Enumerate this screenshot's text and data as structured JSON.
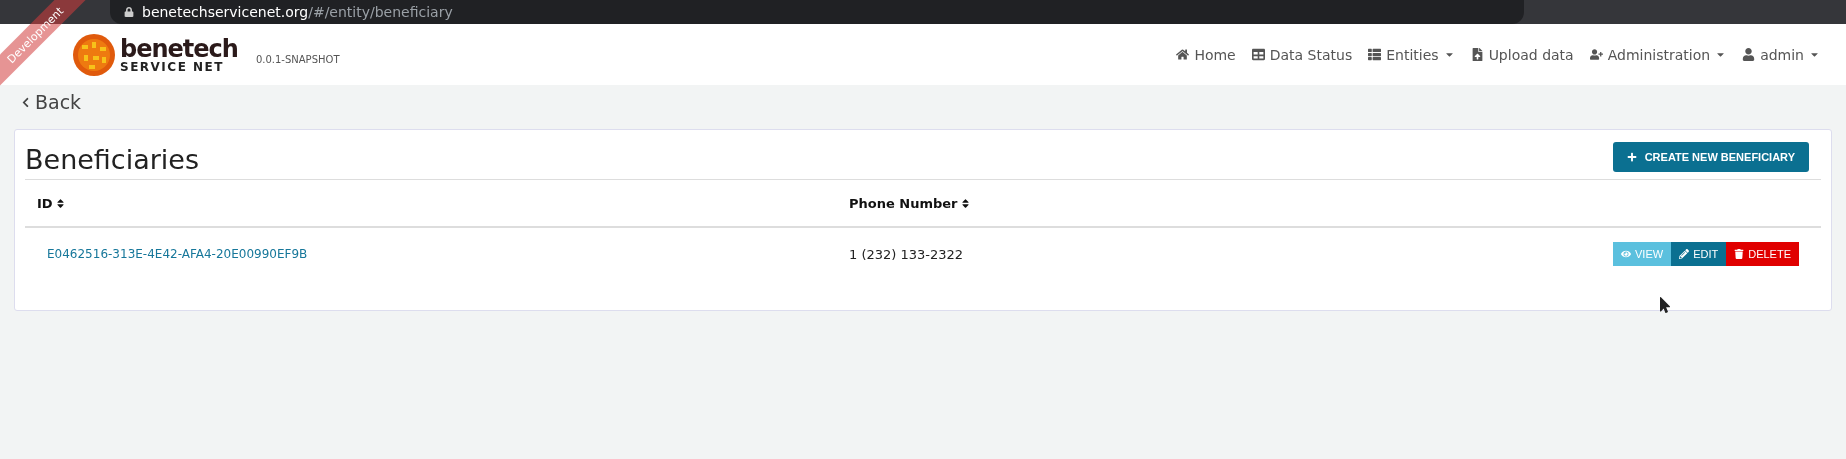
{
  "browser": {
    "url_host": "benetechservicenet.org",
    "url_path": "/#/entity/beneficiary"
  },
  "ribbon": {
    "label": "Development"
  },
  "brand": {
    "name": "benetech",
    "subtitle": "SERVICE NET",
    "version": "0.0.1-SNAPSHOT"
  },
  "nav": [
    {
      "label": "Home",
      "dropdown": false
    },
    {
      "label": "Data Status",
      "dropdown": false
    },
    {
      "label": "Entities",
      "dropdown": true
    },
    {
      "label": "Upload data",
      "dropdown": false
    },
    {
      "label": "Administration",
      "dropdown": true
    },
    {
      "label": "admin",
      "dropdown": true
    }
  ],
  "back": "Back",
  "page": {
    "title": "Beneficiaries",
    "create_button": "CREATE NEW BENEFICIARY"
  },
  "table": {
    "columns": [
      "ID",
      "Phone Number"
    ],
    "rows": [
      {
        "id": "E0462516-313E-4E42-AFA4-20E00990EF9B",
        "phone": "1 (232) 133-2322",
        "actions": [
          {
            "kind": "view",
            "label": "VIEW"
          },
          {
            "kind": "edit",
            "label": "EDIT"
          },
          {
            "kind": "delete",
            "label": "DELETE"
          }
        ]
      }
    ]
  }
}
